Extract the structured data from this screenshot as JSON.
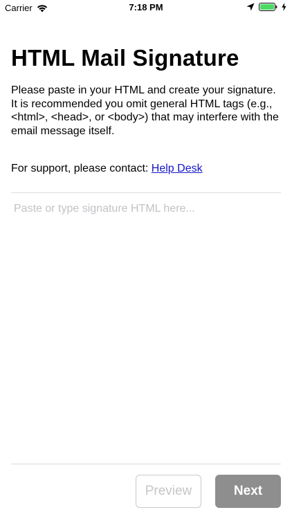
{
  "status_bar": {
    "carrier": "Carrier",
    "time": "7:18 PM",
    "icons": [
      "wifi-icon",
      "location-arrow-icon",
      "battery-icon",
      "charging-bolt-icon"
    ],
    "battery_color": "#4cd964"
  },
  "page": {
    "title": "HTML Mail Signature",
    "description": "Please paste in your HTML and create your signature. It is recommended you omit general HTML tags (e.g., <html>, <head>, or <body>) that may interfere with the email message itself.",
    "support_prefix": "For support, please contact: ",
    "support_link": "Help Desk"
  },
  "editor": {
    "placeholder": "Paste or type signature HTML here...",
    "value": ""
  },
  "actions": {
    "preview_label": "Preview",
    "next_label": "Next"
  },
  "colors": {
    "link": "#1414c8",
    "next_bg": "#8e8e8e",
    "preview_border": "#c8c8c8",
    "divider": "#dddddd"
  }
}
